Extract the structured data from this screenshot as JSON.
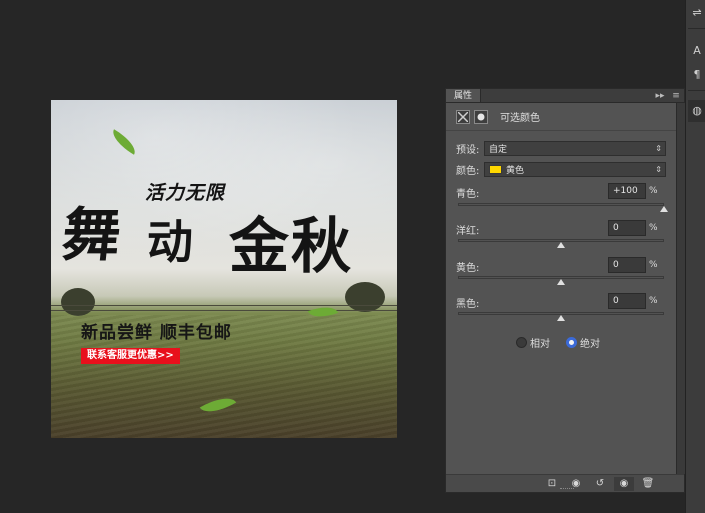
{
  "canvas": {
    "headline_main": "舞",
    "headline_small": "活力无限",
    "headline_2": "动",
    "headline_3": "金秋",
    "subheading": "新品尝鲜 顺丰包邮",
    "promo_button": "联系客服更优惠>>"
  },
  "panel": {
    "tab_label": "属性",
    "collapse_glyph": "▸▸",
    "menu_glyph": "≡",
    "header_title": "可选颜色",
    "preset_label": "预设:",
    "preset_value": "自定",
    "color_label": "颜色:",
    "color_value": "黄色",
    "color_swatch": "#ffd800",
    "sliders": [
      {
        "label": "青色:",
        "value": "+100",
        "unit": "%",
        "position": 1.0
      },
      {
        "label": "洋红:",
        "value": "0",
        "unit": "%",
        "position": 0.5
      },
      {
        "label": "黄色:",
        "value": "0",
        "unit": "%",
        "position": 0.5
      },
      {
        "label": "黑色:",
        "value": "0",
        "unit": "%",
        "position": 0.5
      }
    ],
    "method_relative": "相对",
    "method_absolute": "绝对",
    "selected_method": "绝对"
  },
  "footer": {
    "clip_icon": "⊡",
    "view_prev_icon": "◉",
    "reset_icon": "↺",
    "visibility_icon": "◉",
    "delete_icon": "🗑"
  },
  "dock": {
    "icon1": "⇌",
    "icon2": "A",
    "icon3": "¶",
    "icon4": "◍"
  },
  "colors": {
    "app_bg": "#262626",
    "panel_bg": "#535353",
    "accent": "#3b6ad8",
    "promo_red": "#e8101c"
  }
}
